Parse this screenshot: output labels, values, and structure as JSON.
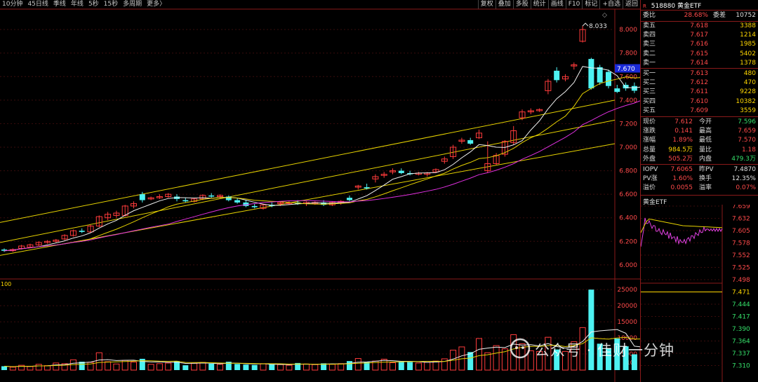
{
  "toolbar": {
    "periods": [
      "10分钟",
      "45日线",
      "季线",
      "年线",
      "5秒",
      "15秒",
      "多周期",
      "更多〉"
    ],
    "tools": [
      "复权",
      "叠加",
      "多股",
      "统计",
      "画线",
      "F10",
      "标记",
      "+自选",
      "返回"
    ]
  },
  "main_chart": {
    "price_axis": [
      "8.000",
      "7.800",
      "7.600",
      "7.400",
      "7.200",
      "7.000",
      "6.800",
      "6.600",
      "6.400",
      "6.200",
      "6.000"
    ],
    "price_range": [
      5.88,
      8.12
    ],
    "current_price_tag": "7.670",
    "high_marker": "8.033",
    "indicator_label": "100",
    "volume_axis": [
      "25000",
      "20000",
      "15000",
      "10000",
      "5000"
    ],
    "volume_unit": "x100",
    "volume_range": [
      0,
      27000
    ]
  },
  "chart_data": {
    "type": "candlestick",
    "candles": [
      [
        6.13,
        6.14,
        6.11,
        6.12
      ],
      [
        6.12,
        6.14,
        6.11,
        6.13
      ],
      [
        6.14,
        6.17,
        6.13,
        6.16
      ],
      [
        6.15,
        6.18,
        6.14,
        6.17
      ],
      [
        6.17,
        6.2,
        6.16,
        6.19
      ],
      [
        6.19,
        6.21,
        6.18,
        6.2
      ],
      [
        6.2,
        6.22,
        6.19,
        6.21
      ],
      [
        6.22,
        6.26,
        6.21,
        6.25
      ],
      [
        6.25,
        6.3,
        6.24,
        6.29
      ],
      [
        6.29,
        6.31,
        6.27,
        6.28
      ],
      [
        6.28,
        6.34,
        6.27,
        6.33
      ],
      [
        6.33,
        6.42,
        6.32,
        6.41
      ],
      [
        6.4,
        6.45,
        6.38,
        6.43
      ],
      [
        6.42,
        6.46,
        6.4,
        6.44
      ],
      [
        6.42,
        6.51,
        6.41,
        6.5
      ],
      [
        6.5,
        6.54,
        6.48,
        6.52
      ],
      [
        6.6,
        6.62,
        6.53,
        6.55
      ],
      [
        6.56,
        6.58,
        6.55,
        6.57
      ],
      [
        6.57,
        6.6,
        6.56,
        6.58
      ],
      [
        6.58,
        6.61,
        6.57,
        6.6
      ],
      [
        6.58,
        6.6,
        6.54,
        6.56
      ],
      [
        6.55,
        6.57,
        6.53,
        6.54
      ],
      [
        6.54,
        6.57,
        6.53,
        6.56
      ],
      [
        6.56,
        6.6,
        6.55,
        6.59
      ],
      [
        6.59,
        6.61,
        6.57,
        6.58
      ],
      [
        6.58,
        6.6,
        6.56,
        6.59
      ],
      [
        6.58,
        6.59,
        6.54,
        6.55
      ],
      [
        6.55,
        6.57,
        6.52,
        6.53
      ],
      [
        6.53,
        6.55,
        6.49,
        6.5
      ],
      [
        6.5,
        6.52,
        6.48,
        6.49
      ],
      [
        6.48,
        6.52,
        6.47,
        6.51
      ],
      [
        6.51,
        6.53,
        6.49,
        6.5
      ],
      [
        6.52,
        6.54,
        6.5,
        6.53
      ],
      [
        6.52,
        6.54,
        6.51,
        6.53
      ],
      [
        6.53,
        6.55,
        6.51,
        6.52
      ],
      [
        6.52,
        6.54,
        6.5,
        6.53
      ],
      [
        6.52,
        6.54,
        6.51,
        6.53
      ],
      [
        6.53,
        6.55,
        6.5,
        6.51
      ],
      [
        6.51,
        6.54,
        6.5,
        6.53
      ],
      [
        6.53,
        6.55,
        6.51,
        6.54
      ],
      [
        6.57,
        6.59,
        6.54,
        6.55
      ],
      [
        6.66,
        6.68,
        6.64,
        6.67
      ],
      [
        6.66,
        6.69,
        6.64,
        6.65
      ],
      [
        6.73,
        6.77,
        6.7,
        6.75
      ],
      [
        6.76,
        6.79,
        6.74,
        6.77
      ],
      [
        6.79,
        6.82,
        6.77,
        6.8
      ],
      [
        6.8,
        6.82,
        6.77,
        6.78
      ],
      [
        6.78,
        6.8,
        6.76,
        6.77
      ],
      [
        6.77,
        6.79,
        6.76,
        6.78
      ],
      [
        6.77,
        6.79,
        6.75,
        6.78
      ],
      [
        6.79,
        6.82,
        6.78,
        6.81
      ],
      [
        6.88,
        6.92,
        6.86,
        6.9
      ],
      [
        6.92,
        7.02,
        6.9,
        7.0
      ],
      [
        7.05,
        7.08,
        7.03,
        7.06
      ],
      [
        7.06,
        7.08,
        7.02,
        7.03
      ],
      [
        7.08,
        7.15,
        7.07,
        7.12
      ],
      [
        6.8,
        7.05,
        6.78,
        6.86
      ],
      [
        6.86,
        6.95,
        6.85,
        6.93
      ],
      [
        6.94,
        7.06,
        6.92,
        7.05
      ],
      [
        7.04,
        7.18,
        7.02,
        7.14
      ],
      [
        7.25,
        7.32,
        7.23,
        7.3
      ],
      [
        7.3,
        7.33,
        7.28,
        7.31
      ],
      [
        7.31,
        7.33,
        7.3,
        7.32
      ],
      [
        7.48,
        7.58,
        7.45,
        7.56
      ],
      [
        7.65,
        7.68,
        7.55,
        7.57
      ],
      [
        7.58,
        7.62,
        7.56,
        7.6
      ],
      [
        7.69,
        7.72,
        7.66,
        7.7
      ],
      [
        7.9,
        8.03,
        7.89,
        8.0
      ],
      [
        7.75,
        7.76,
        7.49,
        7.5
      ],
      [
        7.68,
        7.7,
        7.53,
        7.55
      ],
      [
        7.64,
        7.66,
        7.5,
        7.52
      ],
      [
        7.5,
        7.53,
        7.46,
        7.47
      ],
      [
        7.53,
        7.55,
        7.48,
        7.5
      ],
      [
        7.52,
        7.55,
        7.46,
        7.48
      ],
      [
        7.59,
        7.64,
        7.57,
        7.6
      ]
    ],
    "volume": [
      1200,
      900,
      1500,
      1100,
      1800,
      1400,
      2200,
      2000,
      3200,
      2600,
      2400,
      5400,
      2600,
      1900,
      3000,
      2500,
      3500,
      1800,
      2000,
      2200,
      2800,
      1500,
      2100,
      2400,
      2000,
      1800,
      2600,
      1900,
      1700,
      1600,
      2000,
      1800,
      1700,
      1500,
      2200,
      1900,
      1700,
      2100,
      1800,
      2000,
      2800,
      3600,
      2500,
      2800,
      3400,
      2300,
      2600,
      2500,
      2200,
      2400,
      2800,
      3500,
      6200,
      7200,
      5600,
      9800,
      5400,
      7600,
      6600,
      11000,
      8200,
      6000,
      5800,
      10200,
      6400,
      5800,
      8800,
      13200,
      25000,
      8200,
      6800,
      9800,
      7400,
      4900,
      6900
    ],
    "moving_averages": [
      "white",
      "yellow",
      "magenta"
    ],
    "price_range": [
      5.88,
      8.12
    ],
    "volume_range": [
      0,
      27000
    ]
  },
  "panel": {
    "code": "518880",
    "name": "黄金ETF",
    "commission_ratio": {
      "label": "委比",
      "value": "28.68%",
      "diff_label": "委差",
      "diff_value": "10752"
    },
    "asks": [
      {
        "label": "卖五",
        "price": "7.618",
        "volume": "3388"
      },
      {
        "label": "卖四",
        "price": "7.617",
        "volume": "1214"
      },
      {
        "label": "卖三",
        "price": "7.616",
        "volume": "1985"
      },
      {
        "label": "卖二",
        "price": "7.615",
        "volume": "5402"
      },
      {
        "label": "卖一",
        "price": "7.614",
        "volume": "1378"
      }
    ],
    "bids": [
      {
        "label": "买一",
        "price": "7.613",
        "volume": "480"
      },
      {
        "label": "买二",
        "price": "7.612",
        "volume": "470"
      },
      {
        "label": "买三",
        "price": "7.611",
        "volume": "9228"
      },
      {
        "label": "买四",
        "price": "7.610",
        "volume": "10382"
      },
      {
        "label": "买五",
        "price": "7.609",
        "volume": "3559"
      }
    ],
    "quote": [
      {
        "l1": "现价",
        "v1": "7.612",
        "l2": "今开",
        "v2": "7.596",
        "c1": "red",
        "c2": "green"
      },
      {
        "l1": "涨跌",
        "v1": "0.141",
        "l2": "最高",
        "v2": "7.659",
        "c1": "red",
        "c2": "red"
      },
      {
        "l1": "涨幅",
        "v1": "1.89%",
        "l2": "最低",
        "v2": "7.570",
        "c1": "red",
        "c2": "red"
      },
      {
        "l1": "总量",
        "v1": "984.5万",
        "l2": "量比",
        "v2": "1.18",
        "c1": "yel",
        "c2": "red"
      },
      {
        "l1": "外盘",
        "v1": "505.2万",
        "l2": "内盘",
        "v2": "479.3万",
        "c1": "red",
        "c2": "green"
      }
    ],
    "iopv": [
      {
        "l1": "IOPV",
        "v1": "7.6065",
        "l2": "昨PV",
        "v2": "7.4870",
        "c1": "red",
        "c2": "white"
      },
      {
        "l1": "PV涨",
        "v1": "1.60%",
        "l2": "换手",
        "v2": "12.35%",
        "c1": "red",
        "c2": "white"
      },
      {
        "l1": "溢价",
        "v1": "0.0055",
        "l2": "溢率",
        "v2": "0.07%",
        "c1": "red",
        "c2": "red"
      }
    ],
    "mini_chart": {
      "title": "黄金ETF",
      "axis": [
        "7.659",
        "7.632",
        "7.605",
        "7.578",
        "7.552",
        "7.525",
        "7.498",
        "7.471",
        "7.444",
        "7.417",
        "7.390",
        "7.364",
        "7.337",
        "7.310"
      ],
      "axis_colors": [
        "red",
        "red",
        "red",
        "red",
        "red",
        "red",
        "red",
        "yel",
        "green",
        "green",
        "green",
        "green",
        "green",
        "green"
      ]
    }
  },
  "watermark": "公众号 · 佳财一分钟"
}
